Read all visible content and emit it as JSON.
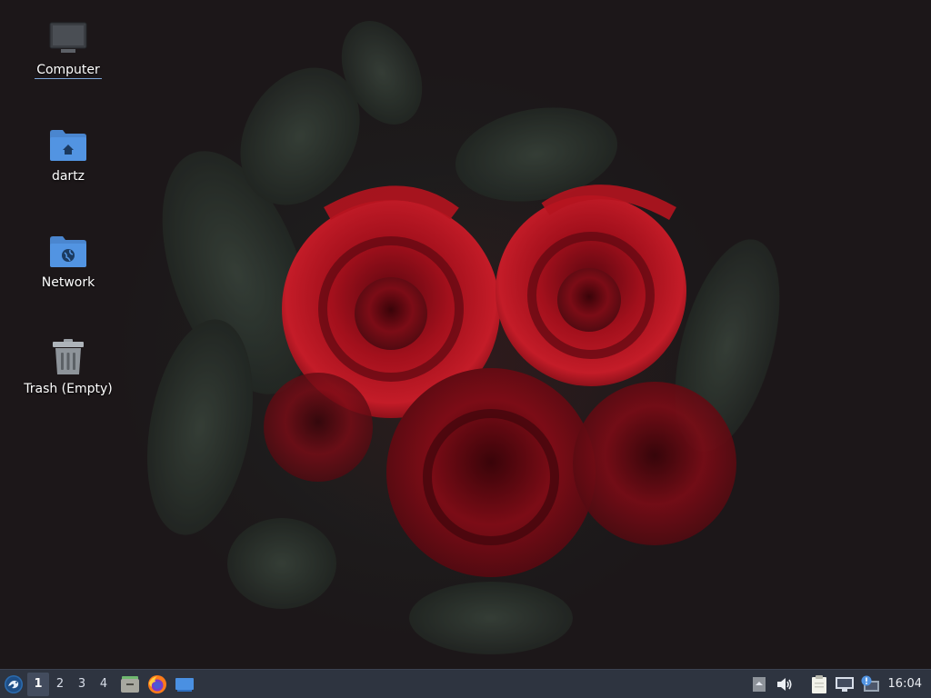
{
  "desktop": {
    "icons": [
      {
        "label": "Computer",
        "icon": "computer-icon"
      },
      {
        "label": "dartz",
        "icon": "home-folder-icon"
      },
      {
        "label": "Network",
        "icon": "network-folder-icon"
      },
      {
        "label": "Trash (Empty)",
        "icon": "trash-icon"
      }
    ]
  },
  "panel": {
    "menu_icon": "xfce-whisker-menu-icon",
    "workspaces": [
      "1",
      "2",
      "3",
      "4"
    ],
    "active_workspace": "1",
    "launchers": [
      "file-manager-icon",
      "firefox-icon",
      "desktop-show-icon"
    ],
    "tray": [
      "tray-expand-icon",
      "volume-icon",
      "clipboard-icon",
      "network-icon",
      "update-notifier-icon"
    ],
    "clock": "16:04"
  },
  "colors": {
    "panel_bg": "#2e3440",
    "folder_blue": "#5294e2",
    "rose_red": "#a8101c",
    "accent": "#7ea6d8"
  }
}
